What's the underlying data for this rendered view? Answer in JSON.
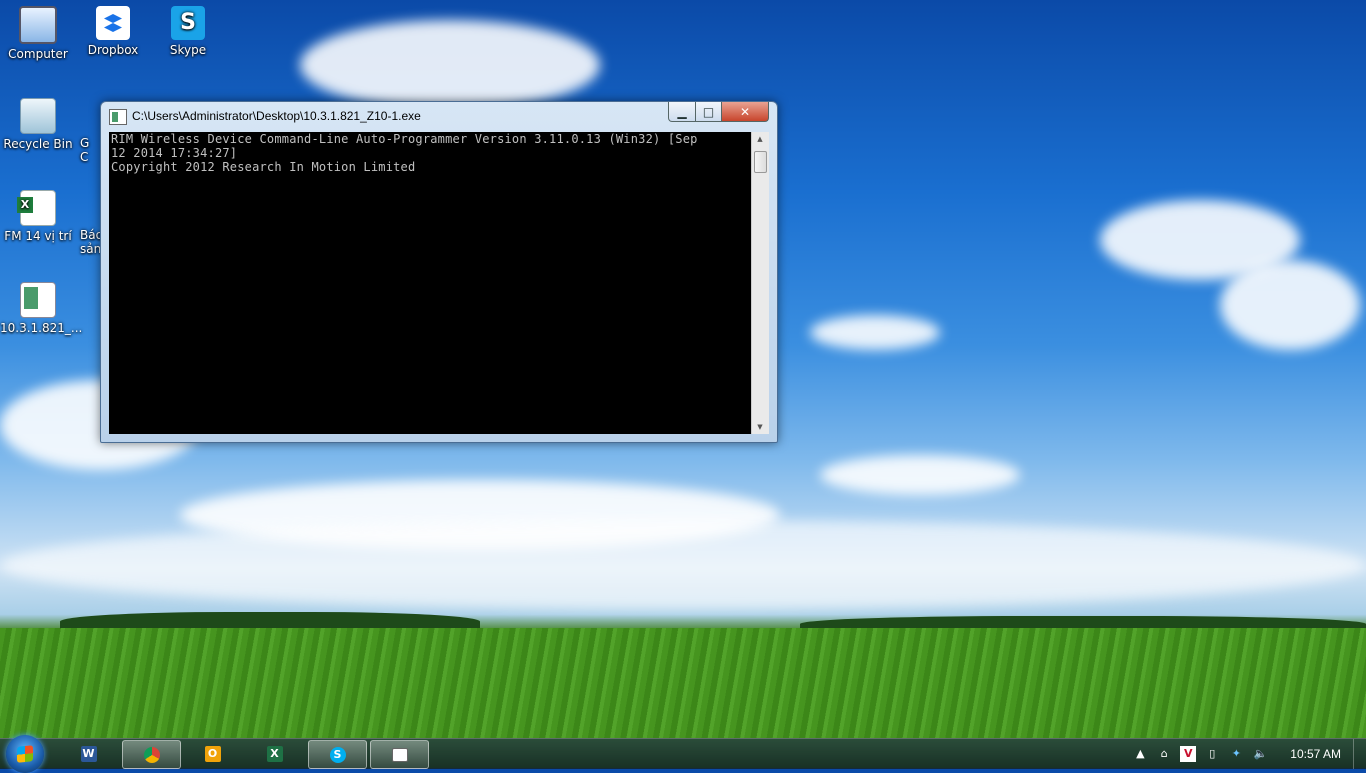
{
  "desktop": {
    "icons": [
      {
        "label": "Computer"
      },
      {
        "label": "Dropbox"
      },
      {
        "label": "Skype"
      },
      {
        "label": "Recycle Bin"
      },
      {
        "label": "FM 14 vị trí"
      },
      {
        "label": "10.3.1.821_..."
      }
    ],
    "partial_labels": [
      "G",
      "C",
      "Báo",
      "sản"
    ]
  },
  "window": {
    "title": "C:\\Users\\Administrator\\Desktop\\10.3.1.821_Z10-1.exe",
    "minimize_glyph": "▁",
    "maximize_glyph": "□",
    "close_glyph": "✕",
    "console_lines": [
      "RIM Wireless Device Command-Line Auto-Programmer Version 3.11.0.13 (Win32) [Sep",
      "12 2014 17:34:27]",
      "Copyright 2012 Research In Motion Limited"
    ],
    "scroll_up_glyph": "▲",
    "scroll_down_glyph": "▼"
  },
  "taskbar": {
    "items": [
      {
        "icon": "word-icon",
        "glyph": "W"
      },
      {
        "icon": "chrome-icon",
        "glyph": ""
      },
      {
        "icon": "outlook-icon",
        "glyph": "O"
      },
      {
        "icon": "excel-icon",
        "glyph": "X"
      },
      {
        "icon": "skype-icon",
        "glyph": "S"
      },
      {
        "icon": "console-icon",
        "glyph": ""
      }
    ],
    "tray": {
      "show_hidden_glyph": "▲",
      "network_glyph": "⌂",
      "vivaldi_glyph": "V",
      "device_glyph": "▯",
      "dropbox_glyph": "✦",
      "volume_glyph": "🔈",
      "clock": "10:57 AM"
    }
  }
}
